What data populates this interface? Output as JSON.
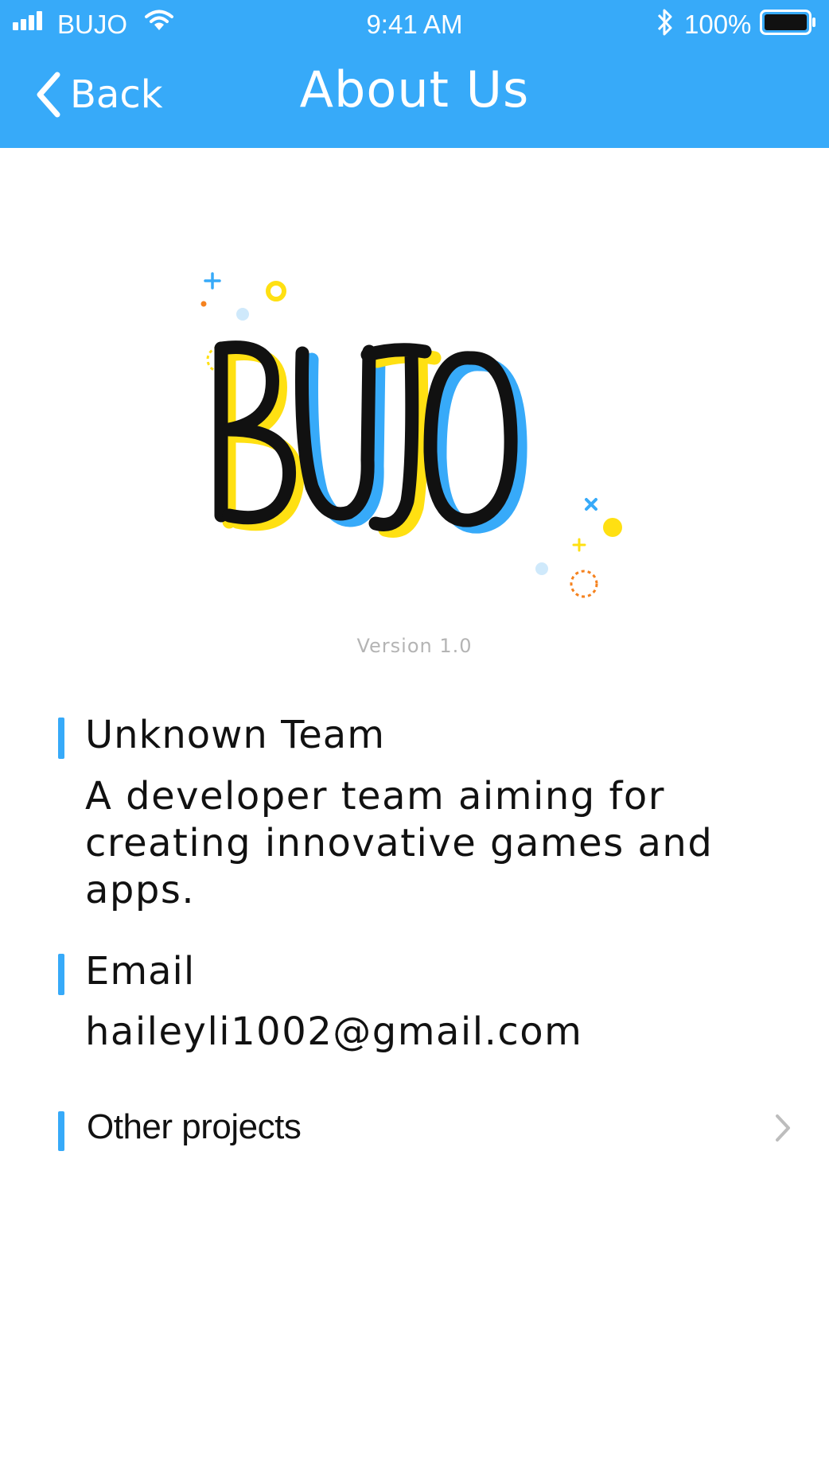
{
  "status_bar": {
    "carrier": "BUJO",
    "time": "9:41 AM",
    "battery": "100%",
    "icons": [
      "signal-icon",
      "wifi-icon",
      "bluetooth-icon",
      "battery-icon"
    ]
  },
  "nav": {
    "back_label": "Back",
    "title": "About Us"
  },
  "logo": {
    "text": "BUJO",
    "colors": {
      "stroke": "#111111",
      "yellow": "#ffe012",
      "blue": "#37aaf9",
      "orange": "#f5821f",
      "light_blue": "#cfe9fb"
    }
  },
  "version": "Version 1.0",
  "team": {
    "title": "Unknown Team",
    "description_lines": [
      "A developer team aiming for",
      "creating innovative games and",
      "apps."
    ]
  },
  "email": {
    "title": "Email",
    "value": "haileyli1002@gmail.com"
  },
  "other_projects": {
    "label": "Other projects",
    "icon": "chevron-right-icon"
  },
  "colors": {
    "accent": "#37aaf9",
    "text": "#111111",
    "muted": "#b4b4b4"
  }
}
